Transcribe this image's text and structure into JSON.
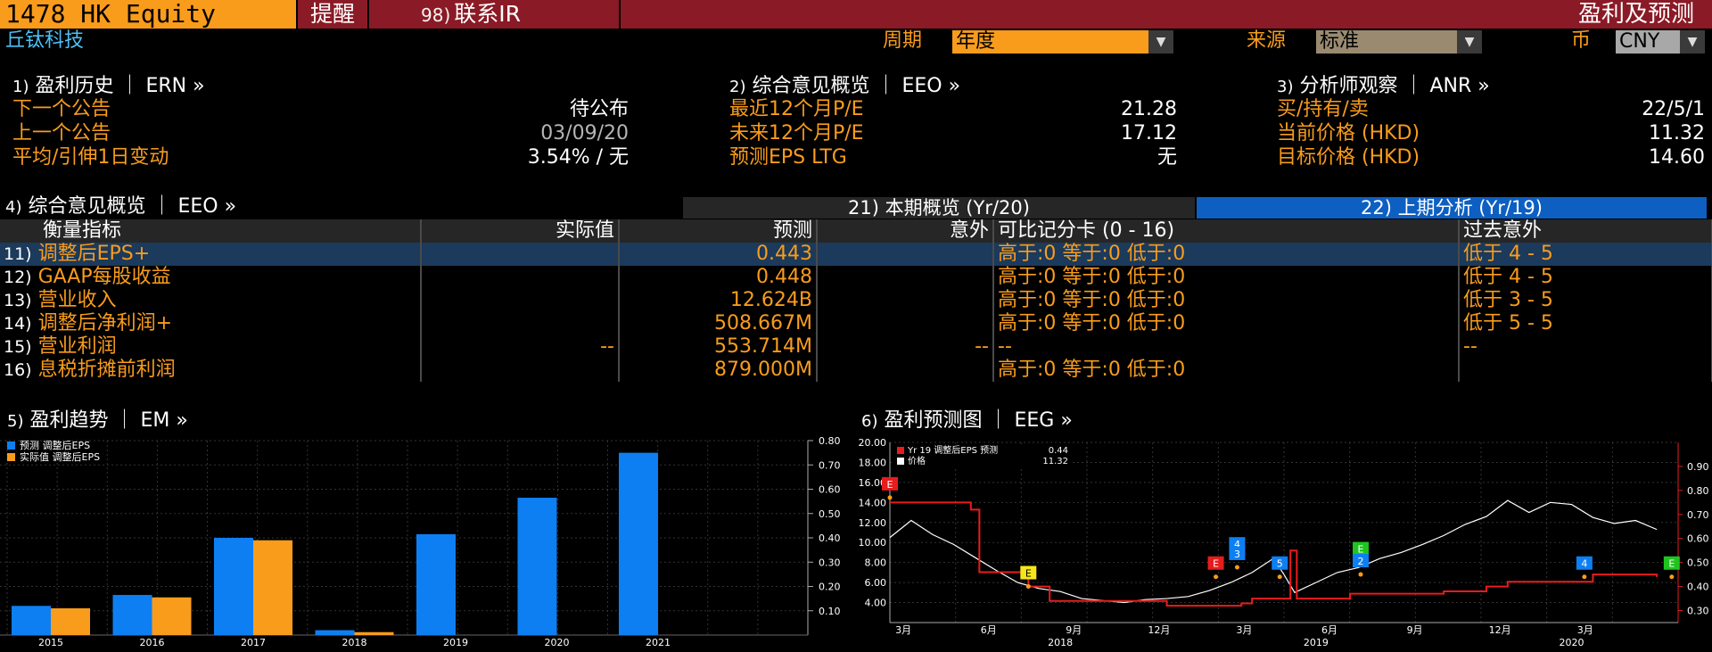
{
  "topbar": {
    "equity": "1478 HK Equity",
    "alert_label": "提醒",
    "contact_ir_num": "98)",
    "contact_ir_label": "联系IR",
    "page_title": "盈利及预测"
  },
  "header": {
    "company": "丘钛科技",
    "period_label": "周期",
    "period_value": "年度",
    "source_label": "来源",
    "source_value": "标准",
    "currency_label": "币",
    "currency_value": "CNY"
  },
  "earnings_history": {
    "num": "1)",
    "title": "盈利历史 ｜ ERN »",
    "next_label": "下一个公告",
    "next_value": "待公布",
    "last_label": "上一个公告",
    "last_value": "03/09/20",
    "avg_label": "平均/引伸1日变动",
    "avg_value": "3.54% / 无"
  },
  "consensus_overview": {
    "num": "2)",
    "title": "综合意见概览 ｜ EEO »",
    "pe_ttm_label": "最近12个月P/E",
    "pe_ttm_value": "21.28",
    "pe_fwd_label": "未来12个月P/E",
    "pe_fwd_value": "17.12",
    "eps_ltg_label": "预测EPS LTG",
    "eps_ltg_value": "无"
  },
  "analyst_view": {
    "num": "3)",
    "title": "分析师观察 ｜ ANR »",
    "rating_label": "买/持有/卖",
    "rating_value": "22/5/1",
    "price_label": "当前价格 (HKD)",
    "price_value": "11.32",
    "target_label": "目标价格 (HKD)",
    "target_value": "14.60"
  },
  "table_section": {
    "num": "4)",
    "title": "综合意见概览 ｜ EEO »",
    "tab_current": "21) 本期概览 (Yr/20)",
    "tab_previous": "22) 上期分析 (Yr/19)",
    "columns": [
      "衡量指标",
      "实际值",
      "预测",
      "意外",
      "可比记分卡 (0 - 16)",
      "过去意外"
    ],
    "rows": [
      {
        "num": "11)",
        "metric": "调整后EPS+",
        "actual": "",
        "estimate": "0.443",
        "surprise": "",
        "score": "高于:0 等于:0 低于:0",
        "past": "低于 4 - 5"
      },
      {
        "num": "12)",
        "metric": "GAAP每股收益",
        "actual": "",
        "estimate": "0.448",
        "surprise": "",
        "score": "高于:0 等于:0 低于:0",
        "past": "低于 4 - 5"
      },
      {
        "num": "13)",
        "metric": "营业收入",
        "actual": "",
        "estimate": "12.624B",
        "surprise": "",
        "score": "高于:0 等于:0 低于:0",
        "past": "低于 3 - 5"
      },
      {
        "num": "14)",
        "metric": "调整后净利润+",
        "actual": "",
        "estimate": "508.667M",
        "surprise": "",
        "score": "高于:0 等于:0 低于:0",
        "past": "低于 5 - 5"
      },
      {
        "num": "15)",
        "metric": "营业利润",
        "actual": "--",
        "estimate": "553.714M",
        "surprise": "--",
        "score": "--",
        "past": "--"
      },
      {
        "num": "16)",
        "metric": "息税折摊前利润",
        "actual": "",
        "estimate": "879.000M",
        "surprise": "",
        "score": "高于:0 等于:0 低于:0",
        "past": ""
      }
    ]
  },
  "trend_section": {
    "num": "5)",
    "title": "盈利趋势 ｜ EM »"
  },
  "forecast_section": {
    "num": "6)",
    "title": "盈利预测图 ｜ EEG »"
  },
  "colors": {
    "orange": "#f99c1c",
    "blue": "#0d7ff2",
    "red": "#e81c1c",
    "topbar": "#8a1a26"
  },
  "chart_data": [
    {
      "type": "bar",
      "categories": [
        "2015",
        "2016",
        "2017",
        "2018",
        "2019",
        "2020",
        "2021"
      ],
      "series": [
        {
          "name": "预测 调整后EPS",
          "values": [
            0.12,
            0.165,
            0.4,
            0.02,
            0.415,
            0.565,
            0.75
          ]
        },
        {
          "name": "实际值 调整后EPS",
          "values": [
            0.11,
            0.155,
            0.39,
            0.012,
            null,
            null,
            null
          ]
        }
      ],
      "ylim": [
        0,
        0.8
      ],
      "y_ticks": [
        "0.10",
        "0.20",
        "0.30",
        "0.40",
        "0.50",
        "0.60",
        "0.70",
        "0.80"
      ],
      "legend": "top-left",
      "grid": true
    },
    {
      "type": "line",
      "x_labels": [
        "3月",
        "6月",
        "9月",
        "12月",
        "3月",
        "6月",
        "9月",
        "12月",
        "3月"
      ],
      "year_labels": [
        "2018",
        "2019",
        "2020"
      ],
      "series": [
        {
          "name": "Yr 19 调整后EPS 预测",
          "last_value": "0.44",
          "axis": "right",
          "points": [
            [
              0,
              0.75
            ],
            [
              3.8,
              0.72
            ],
            [
              4.2,
              0.46
            ],
            [
              6.5,
              0.4
            ],
            [
              7.5,
              0.34
            ],
            [
              13,
              0.32
            ],
            [
              16.5,
              0.33
            ],
            [
              17,
              0.35
            ],
            [
              18.7,
              0.35
            ],
            [
              18.8,
              0.55
            ],
            [
              19.1,
              0.35
            ],
            [
              21.5,
              0.35
            ],
            [
              21.6,
              0.37
            ],
            [
              26,
              0.38
            ],
            [
              28,
              0.4
            ],
            [
              29,
              0.42
            ],
            [
              33,
              0.45
            ],
            [
              36,
              0.44
            ]
          ]
        },
        {
          "name": "价格",
          "last_value": "11.32",
          "axis": "left",
          "points": [
            [
              0,
              10.5
            ],
            [
              1,
              12.2
            ],
            [
              2,
              10.8
            ],
            [
              3,
              9.8
            ],
            [
              4,
              8.5
            ],
            [
              5,
              7.2
            ],
            [
              6,
              6.0
            ],
            [
              7,
              5.4
            ],
            [
              8,
              5.1
            ],
            [
              9,
              4.4
            ],
            [
              10,
              4.2
            ],
            [
              11,
              4.0
            ],
            [
              12,
              4.3
            ],
            [
              13,
              4.4
            ],
            [
              14,
              4.6
            ],
            [
              15,
              5.2
            ],
            [
              16,
              6.0
            ],
            [
              17,
              7.0
            ],
            [
              18,
              8.4
            ],
            [
              18.5,
              6.8
            ],
            [
              19,
              5.0
            ],
            [
              20,
              6.0
            ],
            [
              21,
              7.0
            ],
            [
              22,
              7.5
            ],
            [
              23,
              8.4
            ],
            [
              24,
              9.0
            ],
            [
              25,
              9.8
            ],
            [
              26,
              10.7
            ],
            [
              27,
              11.8
            ],
            [
              28,
              12.6
            ],
            [
              29,
              14.2
            ],
            [
              30,
              13.0
            ],
            [
              31,
              14.0
            ],
            [
              32,
              13.8
            ],
            [
              33,
              12.5
            ],
            [
              34,
              11.9
            ],
            [
              35,
              12.2
            ],
            [
              36,
              11.3
            ]
          ]
        }
      ],
      "left_axis": {
        "ylim": [
          2,
          20
        ],
        "ticks": [
          "4.00",
          "6.00",
          "8.00",
          "10.00",
          "12.00",
          "14.00",
          "16.00",
          "18.00",
          "20.00"
        ]
      },
      "right_axis": {
        "ylim": [
          0.25,
          1.0
        ],
        "ticks": [
          "0.30",
          "0.40",
          "0.50",
          "0.60",
          "0.70",
          "0.80",
          "0.90"
        ]
      },
      "markers": [
        {
          "label": "E",
          "kind": "red",
          "x": 0,
          "y": 0.8
        },
        {
          "label": "E",
          "kind": "yellow",
          "x": 6.5,
          "y": 0.43
        },
        {
          "label": "E",
          "kind": "red",
          "x": 15.3,
          "y": 0.47
        },
        {
          "label": "4",
          "kind": "blue",
          "x": 16.3,
          "y": 0.55
        },
        {
          "label": "3",
          "kind": "blue",
          "x": 16.3,
          "y": 0.51
        },
        {
          "label": "5",
          "kind": "blue",
          "x": 18.3,
          "y": 0.47
        },
        {
          "label": "E",
          "kind": "green",
          "x": 22.1,
          "y": 0.53
        },
        {
          "label": "2",
          "kind": "blue",
          "x": 22.1,
          "y": 0.48
        },
        {
          "label": "4",
          "kind": "blue",
          "x": 32.6,
          "y": 0.47
        },
        {
          "label": "E",
          "kind": "green",
          "x": 36.7,
          "y": 0.47
        }
      ],
      "grid": true
    }
  ]
}
